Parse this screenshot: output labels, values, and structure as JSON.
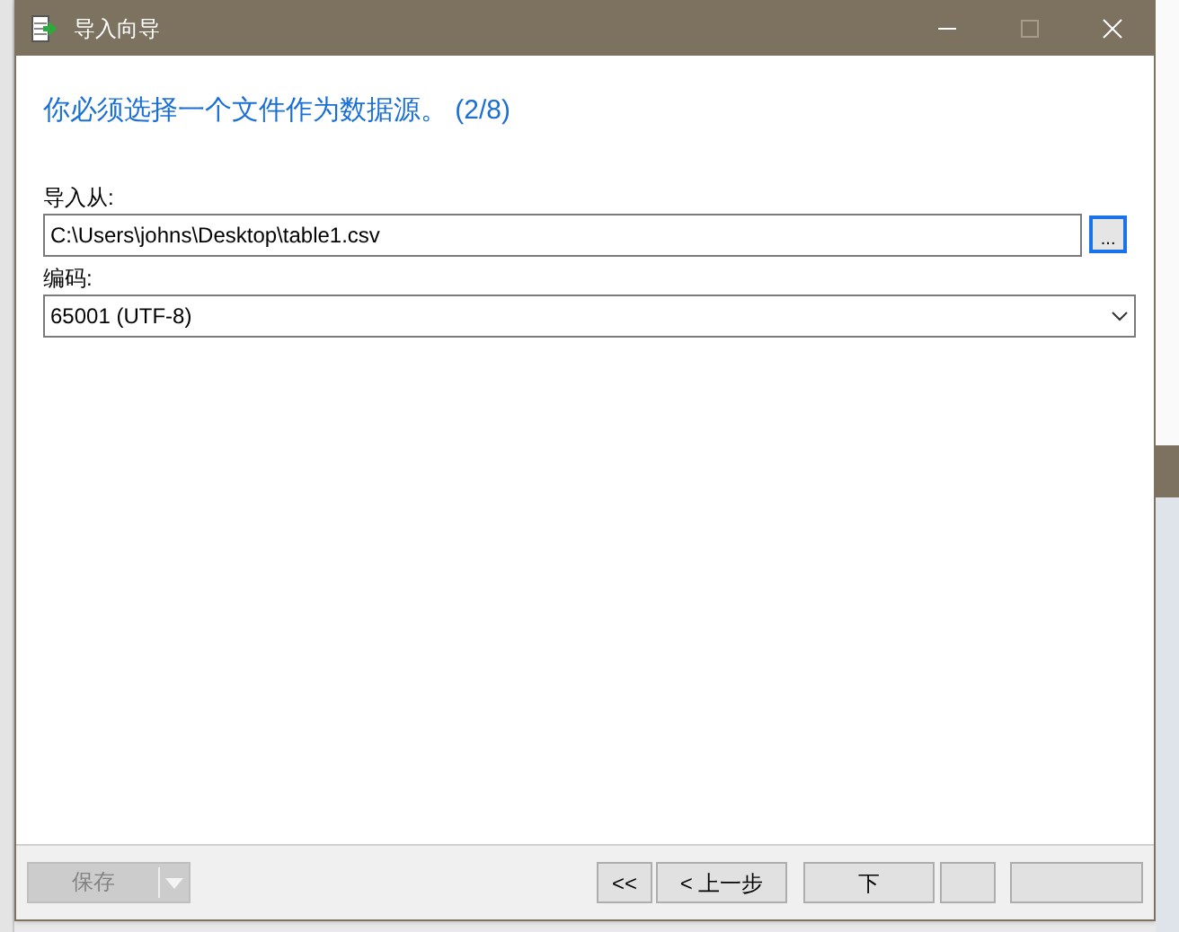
{
  "window": {
    "title": "导入向导"
  },
  "heading": "你必须选择一个文件作为数据源。 (2/8)",
  "source": {
    "label": "导入从:",
    "value": "C:\\Users\\johns\\Desktop\\table1.csv",
    "browse": "..."
  },
  "encoding": {
    "label": "编码:",
    "value": "65001 (UTF-8)"
  },
  "footer": {
    "save": {
      "label": "保存",
      "disabled": true
    },
    "buttons": [
      {
        "label": "<<"
      },
      {
        "label": "< 上一步"
      },
      {
        "label": "下"
      }
    ]
  }
}
